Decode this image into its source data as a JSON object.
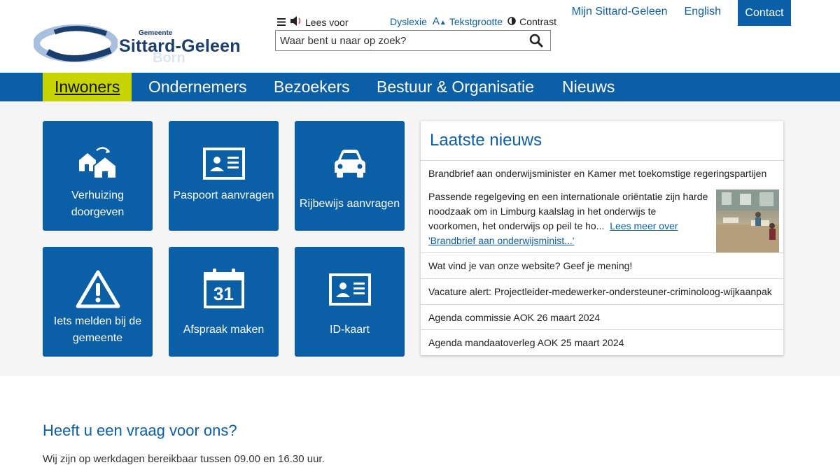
{
  "header": {
    "logo": {
      "small": "Gemeente",
      "main": "Sittard-Geleen",
      "faded": "Born"
    },
    "tools": {
      "read_aloud": "Lees voor",
      "dyslexia": "Dyslexie",
      "text_size": "Tekstgrootte",
      "contrast": "Contrast"
    },
    "search": {
      "placeholder": "Waar bent u naar op zoek?"
    },
    "top_links": {
      "my_account": "Mijn Sittard-Geleen",
      "english": "English",
      "contact": "Contact"
    }
  },
  "nav": {
    "items": [
      {
        "label": "Inwoners"
      },
      {
        "label": "Ondernemers"
      },
      {
        "label": "Bezoekers"
      },
      {
        "label": "Bestuur & Organisatie"
      },
      {
        "label": "Nieuws"
      }
    ]
  },
  "tiles": [
    {
      "label": "Verhuizing doorgeven",
      "icon": "moving-house-icon"
    },
    {
      "label": "Paspoort aanvragen",
      "icon": "passport-card-icon"
    },
    {
      "label": "Rijbewijs aanvragen",
      "icon": "car-icon"
    },
    {
      "label": "Iets melden bij de gemeente",
      "icon": "warning-icon"
    },
    {
      "label": "Afspraak maken",
      "icon": "calendar-icon",
      "calendar_number": "31"
    },
    {
      "label": "ID-kaart",
      "icon": "id-card-icon"
    }
  ],
  "news": {
    "title": "Laatste nieuws",
    "featured": {
      "headline": "Brandbrief aan onderwijsminister en Kamer met toekomstige regeringspartijen",
      "summary": "Passende regelgeving en een internationale oriëntatie zijn harde noodzaak om in Limburg kaalslag in het onderwijs te voorkomen, het onderwijs op peil te ho...",
      "read_more": "Lees meer over 'Brandbrief aan onderwijsminist...'"
    },
    "items": [
      "Wat vind je van onze website? Geef je mening!",
      "Vacature alert: Projectleider-medewerker-ondersteuner-criminoloog-wijkaanpak",
      "Agenda commissie AOK 26 maart 2024",
      "Agenda mandaatoverleg AOK 25 maart 2024"
    ]
  },
  "contact_section": {
    "title": "Heeft u een vraag voor ons?",
    "text": "Wij zijn op werkdagen bereikbaar tussen 09.00 en 16.30 uur."
  },
  "colors": {
    "primary": "#0a5fa6",
    "active_nav": "#c7d400",
    "background": "#f5f5f5"
  }
}
